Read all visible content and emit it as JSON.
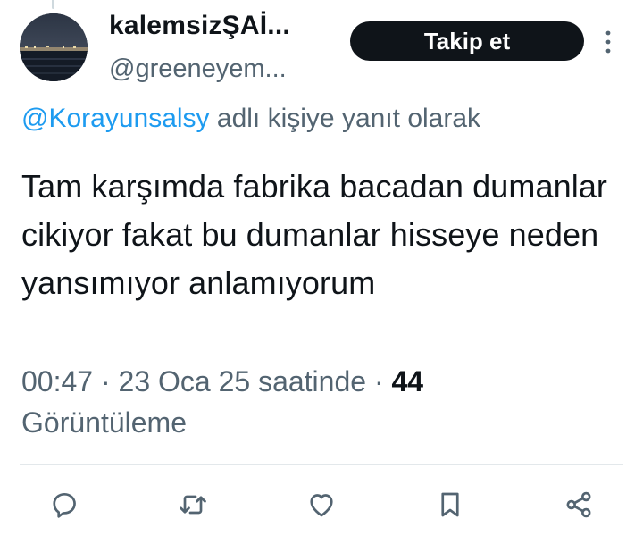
{
  "author": {
    "display_name": "kalemsizŞAİ...",
    "handle": "@greeneyem...",
    "avatar_icon": "profile-photo-night-lake"
  },
  "follow_button": {
    "label": "Takip et"
  },
  "more_icon": "more-vertical-icon",
  "reply_context": {
    "mention": "@Korayunsalsy",
    "suffix": "adlı kişiye yanıt olarak"
  },
  "tweet": {
    "text": "Tam karşımda fabrika bacadan dumanlar cikiyor fakat bu dumanlar hisseye neden yansımıyor anlamıyorum"
  },
  "meta": {
    "time": "00:47",
    "date": "23 Oca 25 saatinde",
    "views_count": "44",
    "views_label": "Görüntüleme",
    "separator": "·"
  },
  "actions": [
    {
      "icon": "reply-icon"
    },
    {
      "icon": "retweet-icon"
    },
    {
      "icon": "like-icon"
    },
    {
      "icon": "bookmark-icon"
    },
    {
      "icon": "share-icon"
    }
  ],
  "colors": {
    "text": "#0f1419",
    "secondary": "#536471",
    "link": "#1d9bf0",
    "button_bg": "#0f1419",
    "button_text": "#ffffff",
    "divider": "#e3e8eb"
  }
}
